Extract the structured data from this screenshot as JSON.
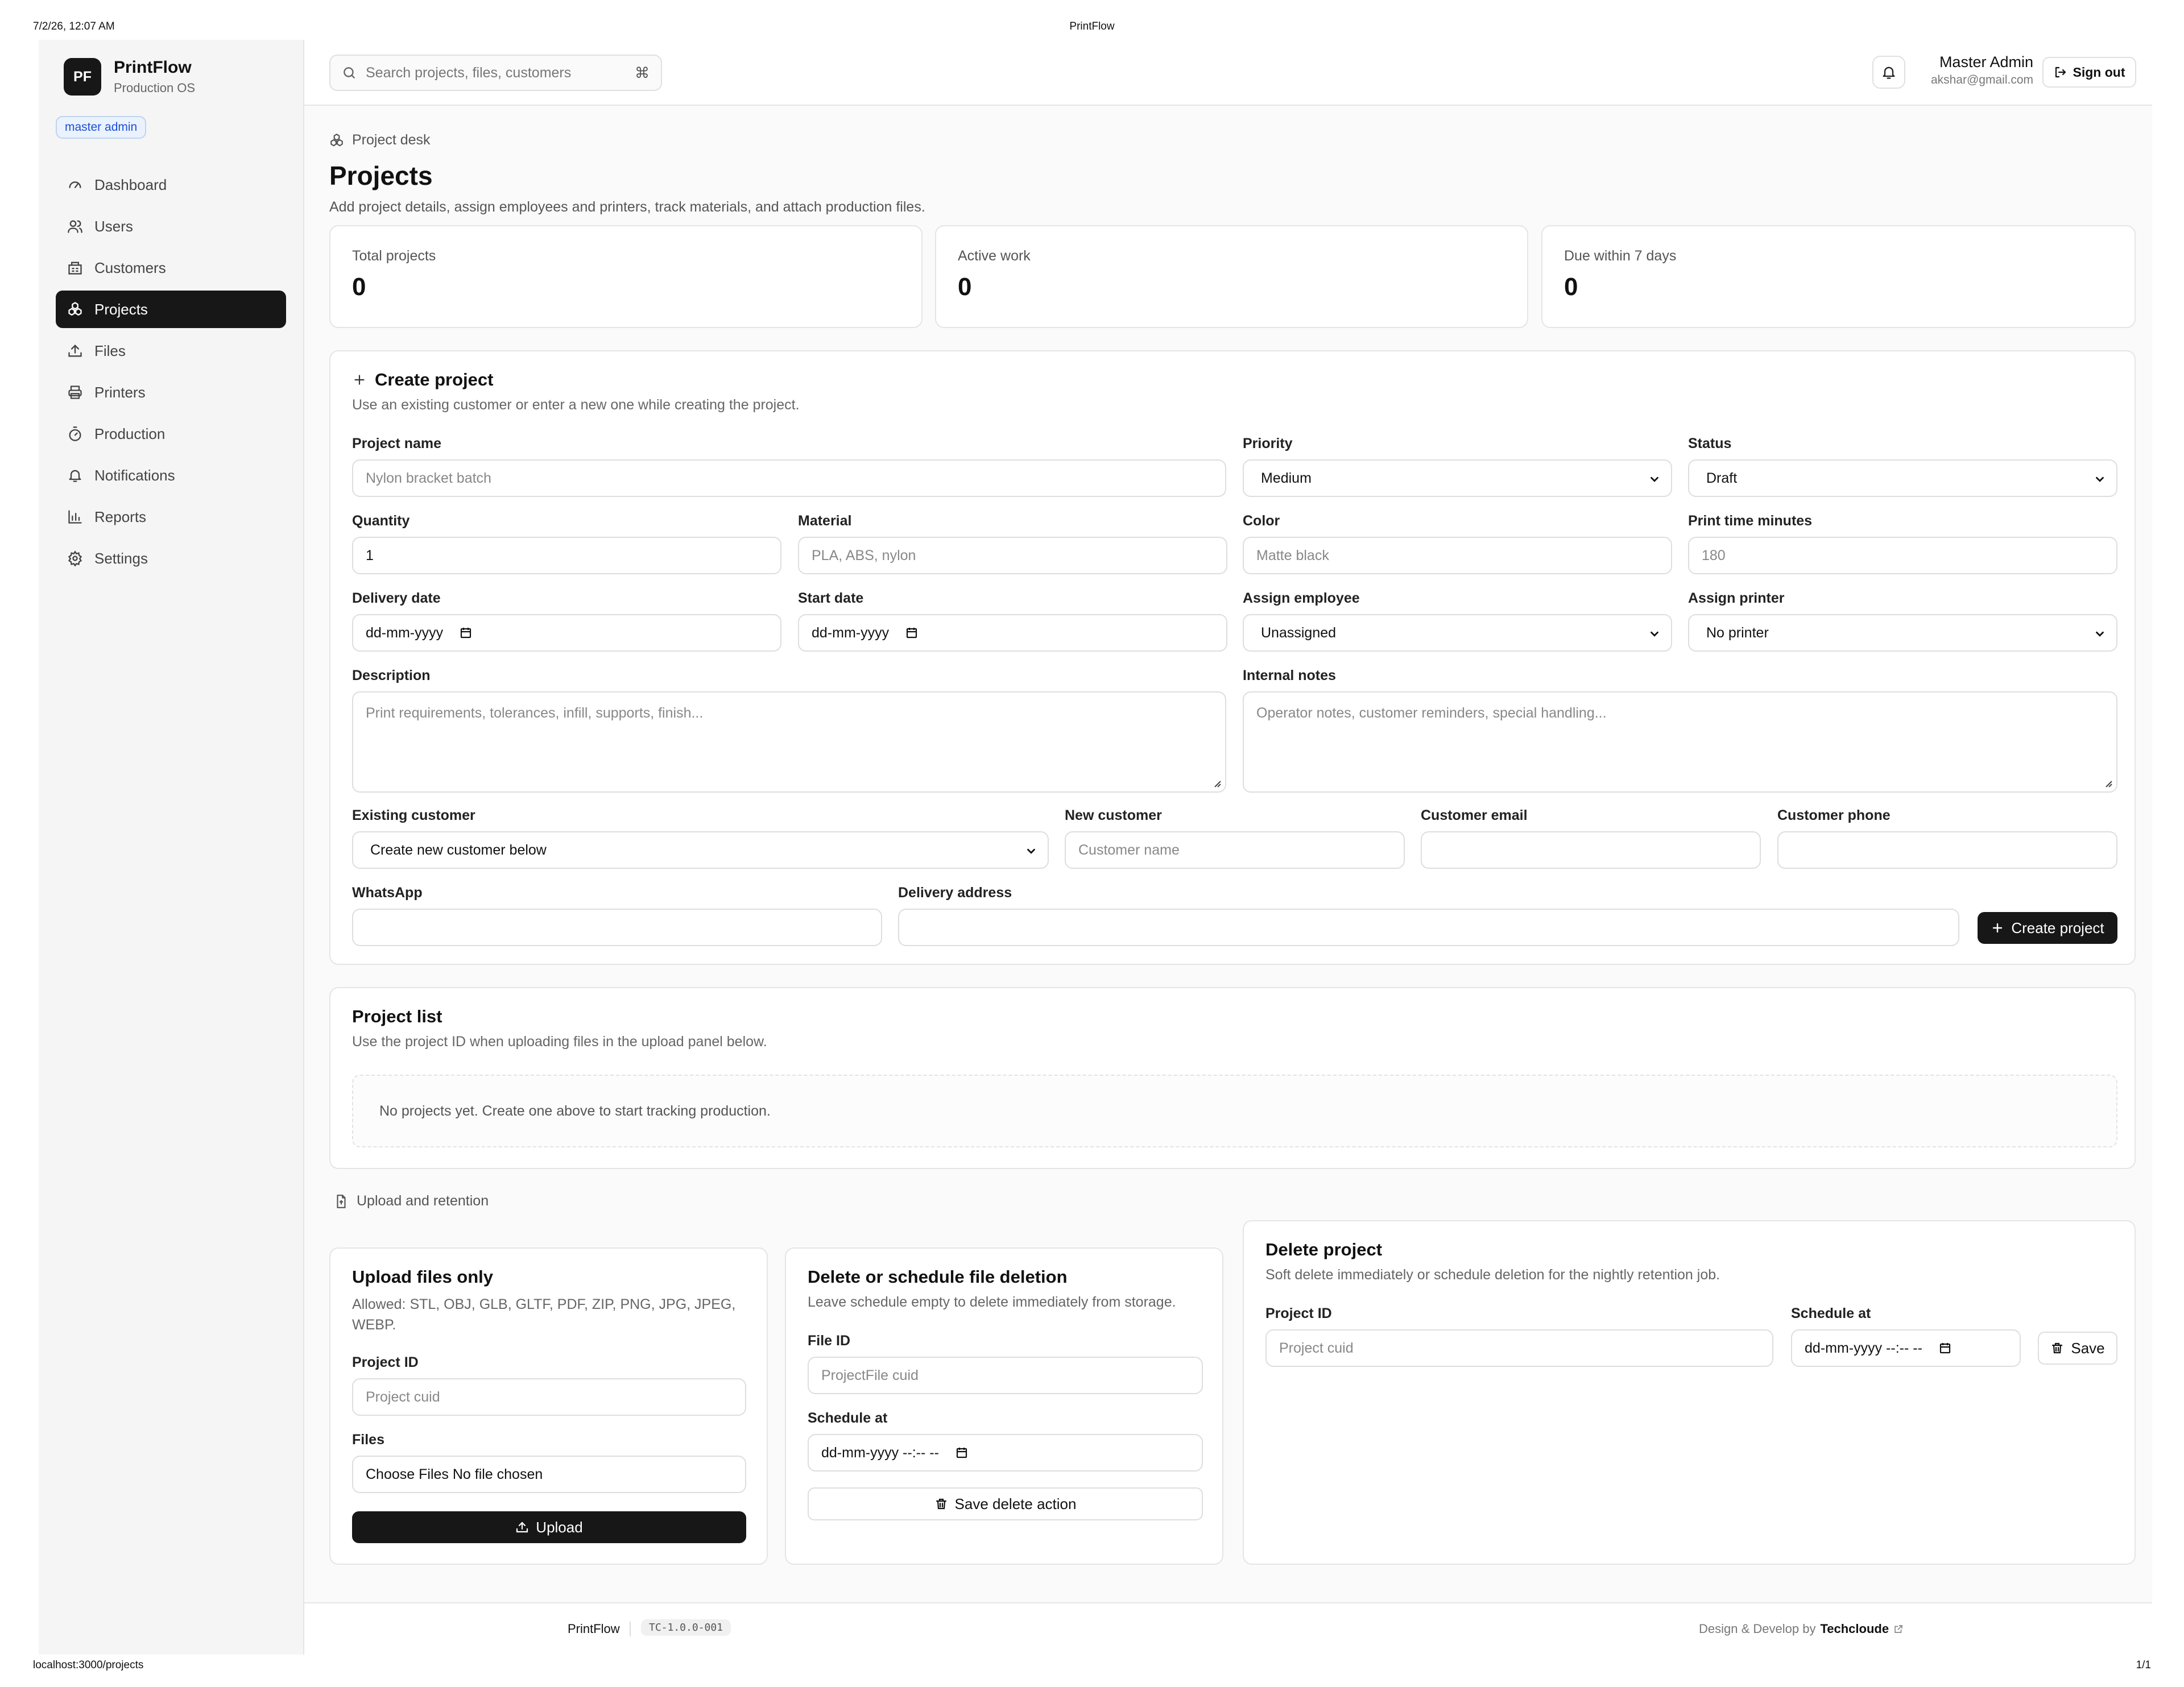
{
  "print": {
    "datetime": "7/2/26, 12:07 AM",
    "title": "PrintFlow",
    "url": "localhost:3000/projects",
    "pages": "1/1"
  },
  "brand": {
    "logo_text": "PF",
    "name": "PrintFlow",
    "subtitle": "Production OS"
  },
  "role_badge": "master admin",
  "nav": [
    {
      "label": "Dashboard",
      "icon": "gauge-icon",
      "active": false
    },
    {
      "label": "Users",
      "icon": "users-icon",
      "active": false
    },
    {
      "label": "Customers",
      "icon": "building-icon",
      "active": false
    },
    {
      "label": "Projects",
      "icon": "boxes-icon",
      "active": true
    },
    {
      "label": "Files",
      "icon": "upload-icon",
      "active": false
    },
    {
      "label": "Printers",
      "icon": "printer-icon",
      "active": false
    },
    {
      "label": "Production",
      "icon": "timer-icon",
      "active": false
    },
    {
      "label": "Notifications",
      "icon": "bell-icon",
      "active": false
    },
    {
      "label": "Reports",
      "icon": "bar-chart-icon",
      "active": false
    },
    {
      "label": "Settings",
      "icon": "gear-icon",
      "active": false
    }
  ],
  "topbar": {
    "search_placeholder": "Search projects, files, customers",
    "search_shortcut": "⌘",
    "user_name": "Master Admin",
    "user_email": "akshar@gmail.com",
    "signout_label": "Sign out"
  },
  "page": {
    "eyebrow": "Project desk",
    "title": "Projects",
    "description": "Add project details, assign employees and printers, track materials, and attach production files."
  },
  "stats": [
    {
      "label": "Total projects",
      "value": "0"
    },
    {
      "label": "Active work",
      "value": "0"
    },
    {
      "label": "Due within 7 days",
      "value": "0"
    }
  ],
  "create": {
    "title": "Create project",
    "description": "Use an existing customer or enter a new one while creating the project.",
    "project_name": {
      "label": "Project name",
      "placeholder": "Nylon bracket batch"
    },
    "priority": {
      "label": "Priority",
      "value": "Medium"
    },
    "status": {
      "label": "Status",
      "value": "Draft"
    },
    "quantity": {
      "label": "Quantity",
      "value": "1"
    },
    "material": {
      "label": "Material",
      "placeholder": "PLA, ABS, nylon"
    },
    "color": {
      "label": "Color",
      "placeholder": "Matte black"
    },
    "print_time": {
      "label": "Print time minutes",
      "placeholder": "180"
    },
    "delivery_date": {
      "label": "Delivery date",
      "value": "dd-mm-yyyy"
    },
    "start_date": {
      "label": "Start date",
      "value": "dd-mm-yyyy"
    },
    "assign_employee": {
      "label": "Assign employee",
      "value": "Unassigned"
    },
    "assign_printer": {
      "label": "Assign printer",
      "value": "No printer"
    },
    "description_field": {
      "label": "Description",
      "placeholder": "Print requirements, tolerances, infill, supports, finish..."
    },
    "internal_notes": {
      "label": "Internal notes",
      "placeholder": "Operator notes, customer reminders, special handling..."
    },
    "existing_customer": {
      "label": "Existing customer",
      "value": "Create new customer below"
    },
    "new_customer": {
      "label": "New customer",
      "placeholder": "Customer name"
    },
    "customer_email": {
      "label": "Customer email",
      "placeholder": ""
    },
    "customer_phone": {
      "label": "Customer phone",
      "placeholder": ""
    },
    "whatsapp": {
      "label": "WhatsApp",
      "placeholder": ""
    },
    "delivery_address": {
      "label": "Delivery address",
      "placeholder": ""
    },
    "submit_label": "Create project"
  },
  "project_list": {
    "title": "Project list",
    "description": "Use the project ID when uploading files in the upload panel below.",
    "empty_text": "No projects yet. Create one above to start tracking production."
  },
  "upload_section": {
    "label": "Upload and retention",
    "upload": {
      "title": "Upload files only",
      "description": "Allowed: STL, OBJ, GLB, GLTF, PDF, ZIP, PNG, JPG, JPEG, WEBP.",
      "project_id_label": "Project ID",
      "project_id_placeholder": "Project cuid",
      "files_label": "Files",
      "files_value": "Choose Files No file chosen",
      "button_label": "Upload"
    },
    "file_deletion": {
      "title": "Delete or schedule file deletion",
      "description": "Leave schedule empty to delete immediately from storage.",
      "file_id_label": "File ID",
      "file_id_placeholder": "ProjectFile cuid",
      "schedule_label": "Schedule at",
      "schedule_value": "dd-mm-yyyy --:-- --",
      "button_label": "Save delete action"
    },
    "delete_project": {
      "title": "Delete project",
      "description": "Soft delete immediately or schedule deletion for the nightly retention job.",
      "project_id_label": "Project ID",
      "project_id_placeholder": "Project cuid",
      "schedule_label": "Schedule at",
      "schedule_value": "dd-mm-yyyy --:-- --",
      "button_label": "Save"
    }
  },
  "footer": {
    "brand": "PrintFlow",
    "version": "TC-1.0.0-001",
    "credit_prefix": "Design & Develop by",
    "credit_name": "Techcloude"
  }
}
